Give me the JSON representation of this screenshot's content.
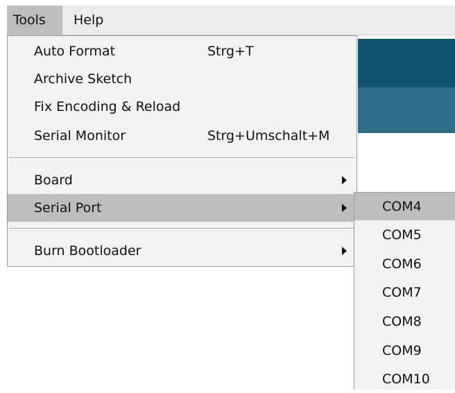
{
  "menubar": {
    "tools_label": "Tools",
    "help_label": "Help"
  },
  "tools_menu": {
    "items": [
      {
        "label": "Auto Format",
        "shortcut": "Strg+T"
      },
      {
        "label": "Archive Sketch",
        "shortcut": ""
      },
      {
        "label": "Fix Encoding & Reload",
        "shortcut": ""
      },
      {
        "label": "Serial Monitor",
        "shortcut": "Strg+Umschalt+M"
      },
      {
        "label": "Board",
        "has_submenu": true
      },
      {
        "label": "Serial Port",
        "has_submenu": true,
        "highlighted": true
      },
      {
        "label": "Burn Bootloader",
        "has_submenu": true
      }
    ]
  },
  "serial_port_menu": {
    "items": [
      {
        "label": "COM4",
        "highlighted": true
      },
      {
        "label": "COM5"
      },
      {
        "label": "COM6"
      },
      {
        "label": "COM7"
      },
      {
        "label": "COM8"
      },
      {
        "label": "COM9"
      },
      {
        "label": "COM10"
      }
    ]
  },
  "colors": {
    "highlight": "#bdbdbd",
    "menu_bg": "#f2f2f2",
    "toolbar_dark": "#0f5470",
    "toolbar_light": "#2e6d88"
  }
}
